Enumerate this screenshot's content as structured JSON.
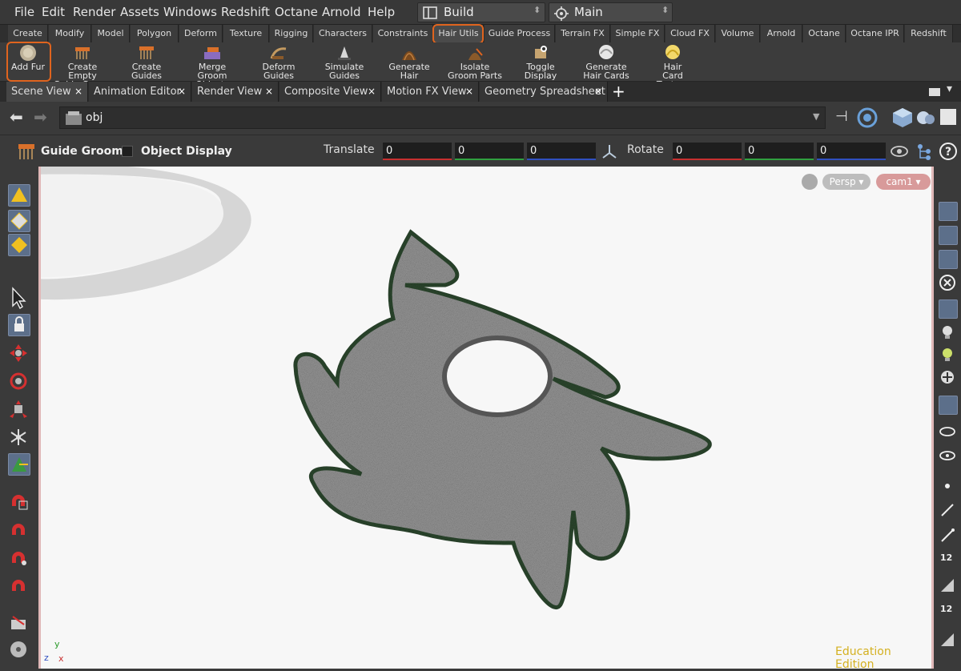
{
  "menubar": {
    "items": [
      "File",
      "Edit",
      "Render",
      "Assets",
      "Windows",
      "Redshift",
      "Octane",
      "Arnold",
      "Help"
    ],
    "desktop": "Build",
    "session": "Main"
  },
  "shelf_tabs": [
    "Create",
    "Modify",
    "Model",
    "Polygon",
    "Deform",
    "Texture",
    "Rigging",
    "Characters",
    "Constraints",
    "Hair Utils",
    "Guide Process",
    "Terrain FX",
    "Simple FX",
    "Cloud FX",
    "Volume",
    "Arnold",
    "Octane",
    "Octane IPR",
    "Redshift"
  ],
  "active_shelf": "Hair Utils",
  "tools": [
    {
      "l1": "Add Fur",
      "l2": ""
    },
    {
      "l1": "Create Empty",
      "l2": "Guide Groom"
    },
    {
      "l1": "Create Guides",
      "l2": ""
    },
    {
      "l1": "Merge Groom",
      "l2": "Objects"
    },
    {
      "l1": "Deform",
      "l2": "Guides"
    },
    {
      "l1": "Simulate",
      "l2": "Guides"
    },
    {
      "l1": "Generate Hair",
      "l2": ""
    },
    {
      "l1": "Isolate",
      "l2": "Groom Parts"
    },
    {
      "l1": "Toggle",
      "l2": "Display"
    },
    {
      "l1": "Generate",
      "l2": "Hair Cards"
    },
    {
      "l1": "Hair",
      "l2": "Card Texture"
    }
  ],
  "pane_tabs": [
    "Scene View",
    "Animation Editor",
    "Render View",
    "Composite View",
    "Motion FX View",
    "Geometry Spreadsheet"
  ],
  "path": "obj",
  "operator": {
    "name": "Guide Groom",
    "object_display": "Object Display",
    "translate_label": "Translate",
    "rotate_label": "Rotate",
    "translate": [
      "0",
      "0",
      "0"
    ],
    "rotate": [
      "0",
      "0",
      "0"
    ]
  },
  "viewport": {
    "persp": "Persp",
    "camera": "cam1",
    "watermark": "Education Edition",
    "axis_y": "y",
    "axis_z": "z",
    "axis_x": "x"
  },
  "right_toolbar": {
    "label1": "12",
    "label2": "12"
  },
  "colors": {
    "accent": "#e0641e",
    "fur": "#9a9a9a"
  }
}
